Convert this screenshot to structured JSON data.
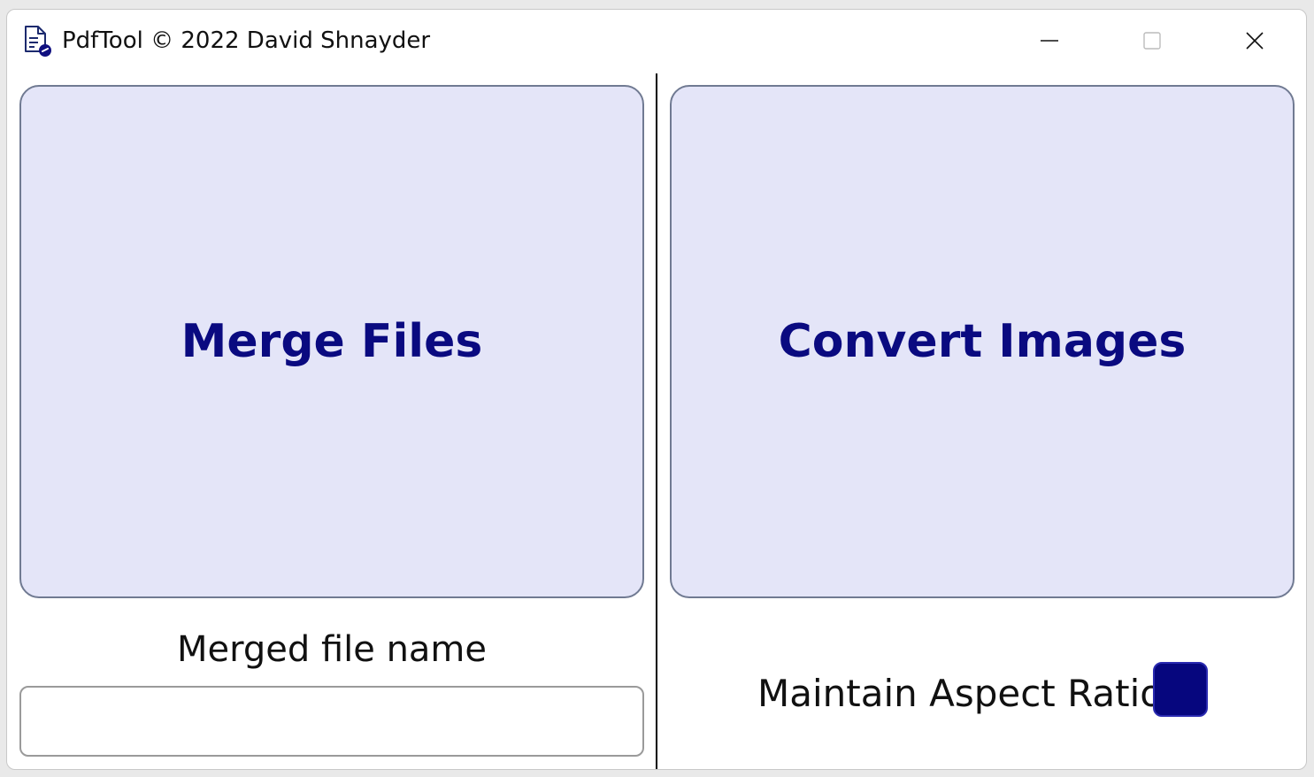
{
  "window": {
    "title": "PdfTool © 2022 David Shnayder",
    "controls": {
      "minimize_icon": "minimize-icon",
      "maximize_icon": "maximize-icon",
      "close_icon": "close-icon"
    },
    "app_icon": "pdf-document-icon"
  },
  "left_panel": {
    "merge_button_label": "Merge Files",
    "merged_name_label": "Merged file name",
    "merged_name_value": "",
    "merged_name_placeholder": ""
  },
  "right_panel": {
    "convert_button_label": "Convert Images",
    "aspect_ratio_label": "Maintain Aspect Ratio",
    "aspect_ratio_checked": true
  },
  "colors": {
    "button_background": "#e4e5f8",
    "button_text": "#0a0a80",
    "toggle_fill": "#06067e",
    "divider": "#000000"
  }
}
